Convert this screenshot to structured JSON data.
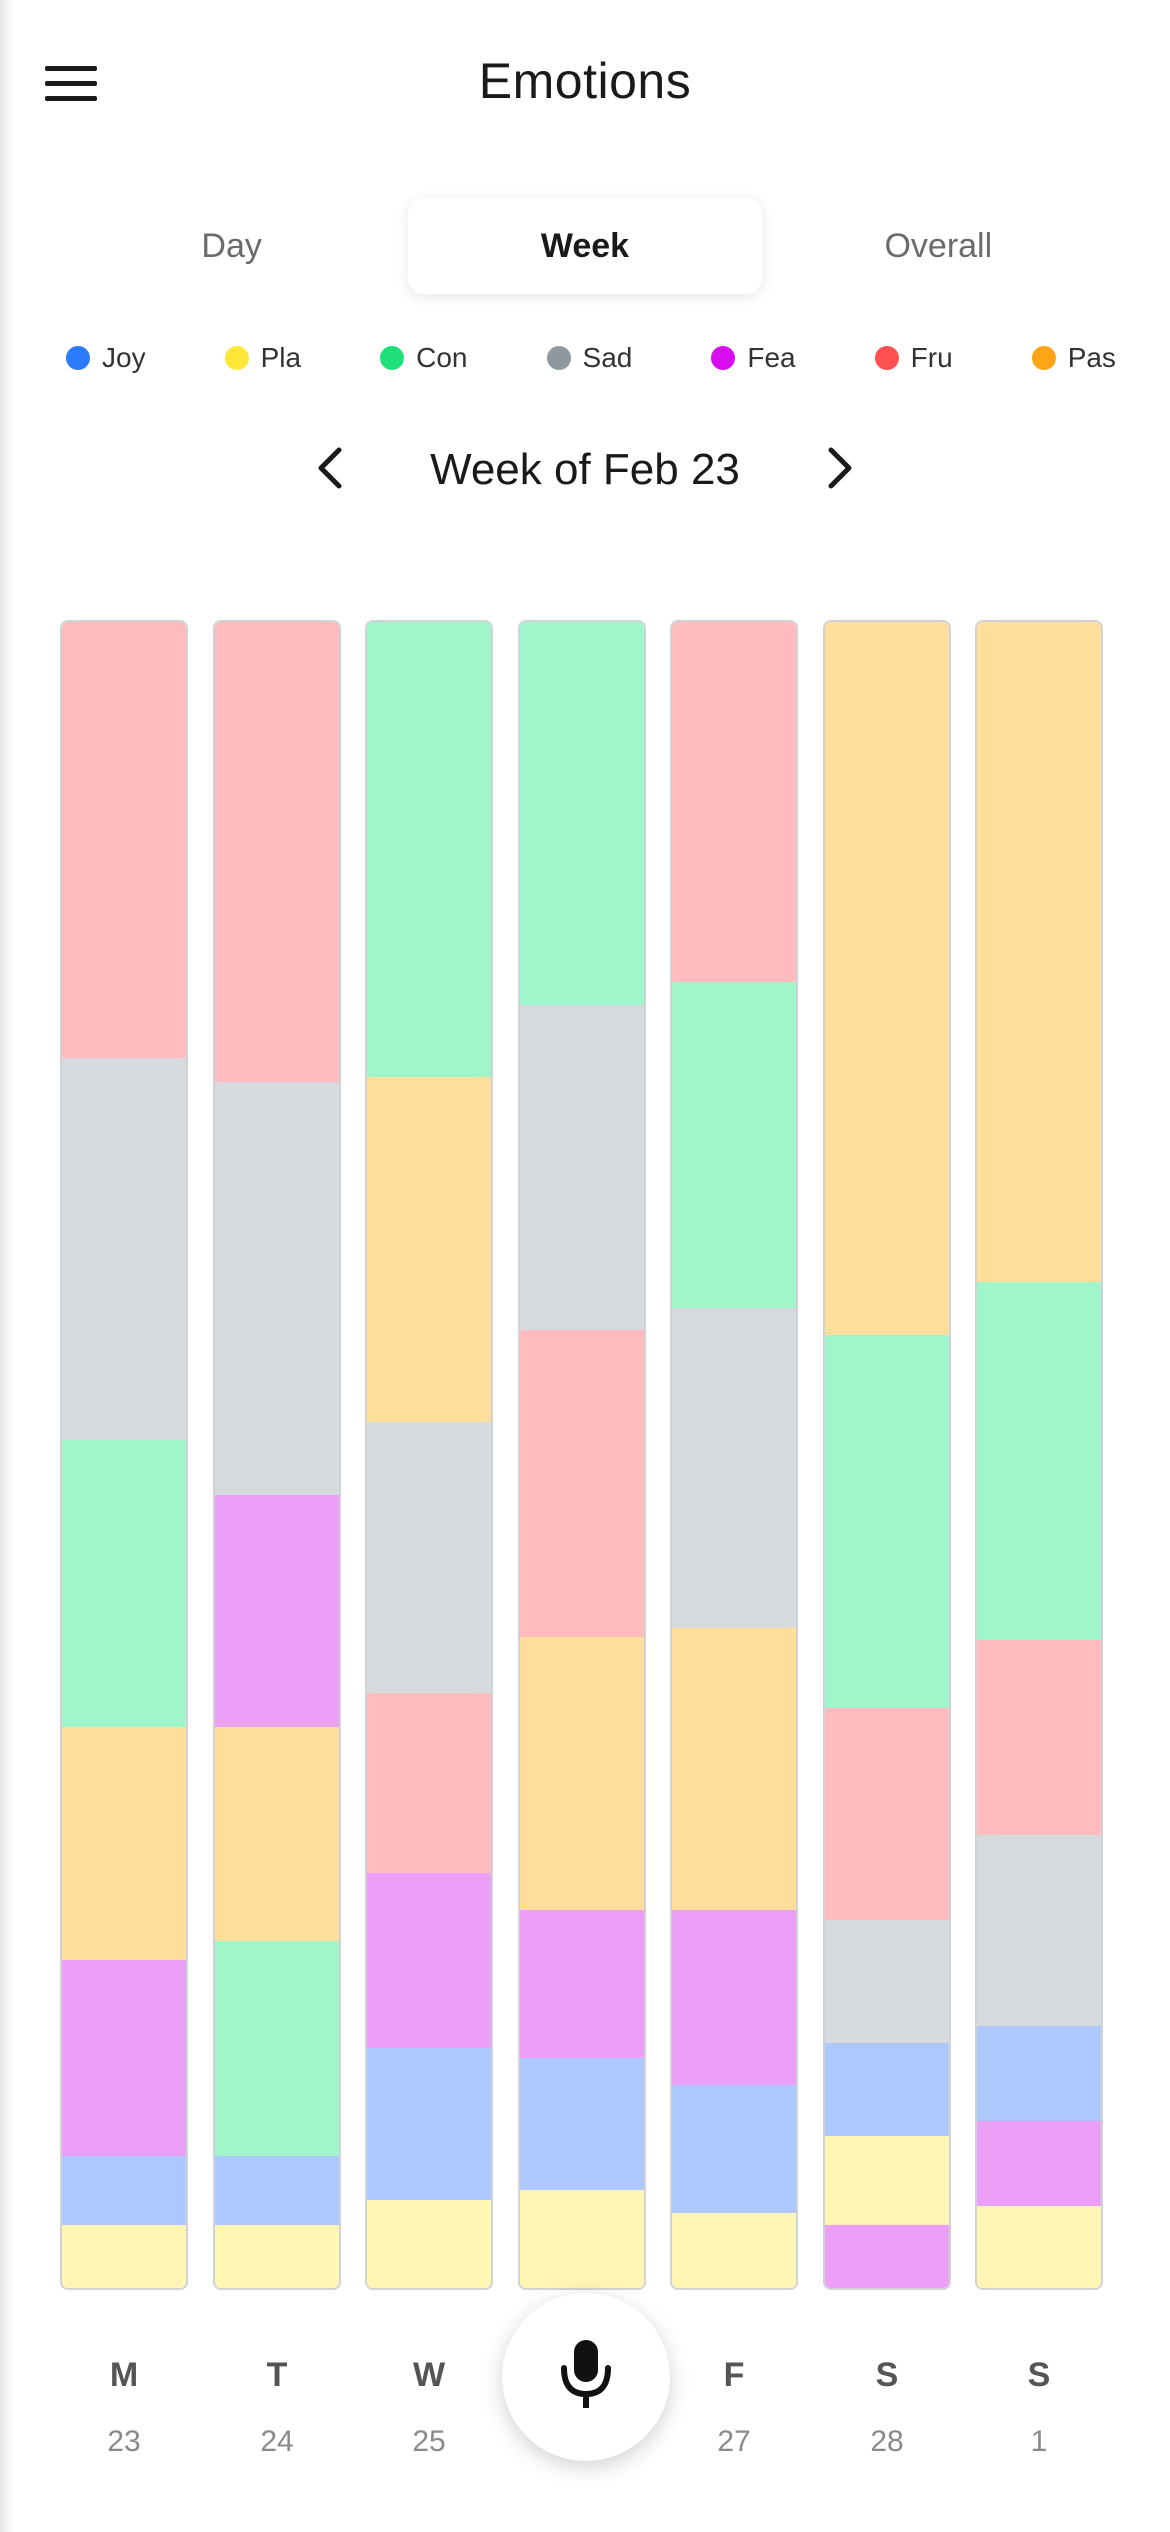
{
  "header": {
    "title": "Emotions"
  },
  "icons": {
    "menu": "hamburger-menu-icon",
    "prev": "chevron-left-icon",
    "next": "chevron-right-icon",
    "mic": "microphone-icon"
  },
  "tabs": [
    {
      "label": "Day",
      "active": false
    },
    {
      "label": "Week",
      "active": true
    },
    {
      "label": "Overall",
      "active": false
    }
  ],
  "legend": [
    {
      "key": "joy",
      "label": "Joy",
      "dot": "#2b7bff",
      "fill": "#adc8fc"
    },
    {
      "key": "pla",
      "label": "Pla",
      "dot": "#ffe838",
      "fill": "#fff6b3"
    },
    {
      "key": "con",
      "label": "Con",
      "dot": "#1fe07a",
      "fill": "#a0f5cb"
    },
    {
      "key": "sad",
      "label": "Sad",
      "dot": "#8d999f",
      "fill": "#d6dadd"
    },
    {
      "key": "fea",
      "label": "Fea",
      "dot": "#d90ef0",
      "fill": "#ec9ff7"
    },
    {
      "key": "fru",
      "label": "Fru",
      "dot": "#ff5050",
      "fill": "#ffbcbe"
    },
    {
      "key": "pas",
      "label": "Pas",
      "dot": "#ffa414",
      "fill": "#fddf9b"
    }
  ],
  "week_nav": {
    "label": "Week of Feb 23"
  },
  "chart_data": {
    "type": "bar",
    "stacked": true,
    "normalized": true,
    "days": [
      {
        "letter": "M",
        "date": "23",
        "segments": [
          {
            "k": "fru",
            "v": 26.2
          },
          {
            "k": "sad",
            "v": 22.9
          },
          {
            "k": "con",
            "v": 17.2
          },
          {
            "k": "pas",
            "v": 14.0
          },
          {
            "k": "fea",
            "v": 11.8
          },
          {
            "k": "joy",
            "v": 4.1
          },
          {
            "k": "pla",
            "v": 3.8
          }
        ]
      },
      {
        "letter": "T",
        "date": "24",
        "segments": [
          {
            "k": "fru",
            "v": 27.6
          },
          {
            "k": "sad",
            "v": 24.8
          },
          {
            "k": "fea",
            "v": 13.9
          },
          {
            "k": "pas",
            "v": 12.9
          },
          {
            "k": "con",
            "v": 12.9
          },
          {
            "k": "joy",
            "v": 4.1
          },
          {
            "k": "pla",
            "v": 3.8
          }
        ]
      },
      {
        "letter": "W",
        "date": "25",
        "segments": [
          {
            "k": "con",
            "v": 27.3
          },
          {
            "k": "pas",
            "v": 20.7
          },
          {
            "k": "sad",
            "v": 16.3
          },
          {
            "k": "fru",
            "v": 10.8
          },
          {
            "k": "fea",
            "v": 10.5
          },
          {
            "k": "joy",
            "v": 9.1
          },
          {
            "k": "pla",
            "v": 5.3
          }
        ]
      },
      {
        "letter": "",
        "date": "",
        "segments": [
          {
            "k": "con",
            "v": 23.0
          },
          {
            "k": "sad",
            "v": 19.5
          },
          {
            "k": "fru",
            "v": 18.4
          },
          {
            "k": "pas",
            "v": 16.4
          },
          {
            "k": "fea",
            "v": 8.9
          },
          {
            "k": "joy",
            "v": 7.9
          },
          {
            "k": "pla",
            "v": 5.9
          }
        ]
      },
      {
        "letter": "F",
        "date": "27",
        "segments": [
          {
            "k": "fru",
            "v": 21.6
          },
          {
            "k": "con",
            "v": 19.6
          },
          {
            "k": "sad",
            "v": 19.2
          },
          {
            "k": "pas",
            "v": 16.9
          },
          {
            "k": "fea",
            "v": 10.5
          },
          {
            "k": "joy",
            "v": 7.7
          },
          {
            "k": "pla",
            "v": 4.5
          }
        ]
      },
      {
        "letter": "S",
        "date": "28",
        "segments": [
          {
            "k": "pas",
            "v": 42.8
          },
          {
            "k": "con",
            "v": 22.4
          },
          {
            "k": "fru",
            "v": 12.7
          },
          {
            "k": "sad",
            "v": 7.4
          },
          {
            "k": "joy",
            "v": 5.6
          },
          {
            "k": "pla",
            "v": 5.3
          },
          {
            "k": "fea",
            "v": 3.8
          }
        ]
      },
      {
        "letter": "S",
        "date": "1",
        "segments": [
          {
            "k": "pas",
            "v": 39.6
          },
          {
            "k": "con",
            "v": 21.5
          },
          {
            "k": "fru",
            "v": 11.7
          },
          {
            "k": "sad",
            "v": 11.5
          },
          {
            "k": "joy",
            "v": 5.7
          },
          {
            "k": "fea",
            "v": 5.1
          },
          {
            "k": "pla",
            "v": 4.9
          }
        ]
      }
    ]
  }
}
